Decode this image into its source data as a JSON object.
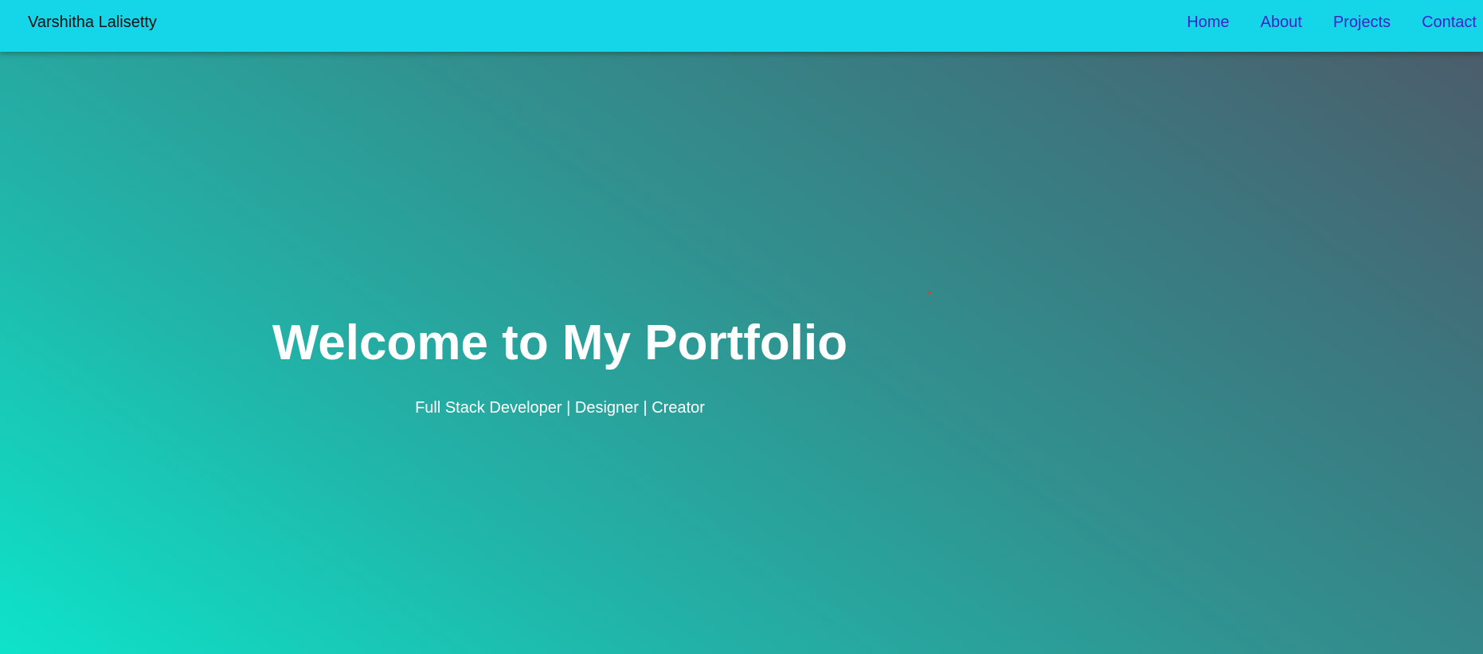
{
  "navbar": {
    "brand": "Varshitha Lalisetty",
    "links": [
      {
        "label": "Home"
      },
      {
        "label": "About"
      },
      {
        "label": "Projects"
      },
      {
        "label": "Contact"
      }
    ],
    "background": "#15d6e8",
    "link_color": "#3a25c9"
  },
  "hero": {
    "title": "Welcome to My Portfolio",
    "subtitle": "Full Stack Developer | Designer | Creator",
    "gradient_colors": [
      "#0ee3c9",
      "#22b2a7",
      "#31918f",
      "#3a7a81",
      "#4b5d6b"
    ]
  }
}
